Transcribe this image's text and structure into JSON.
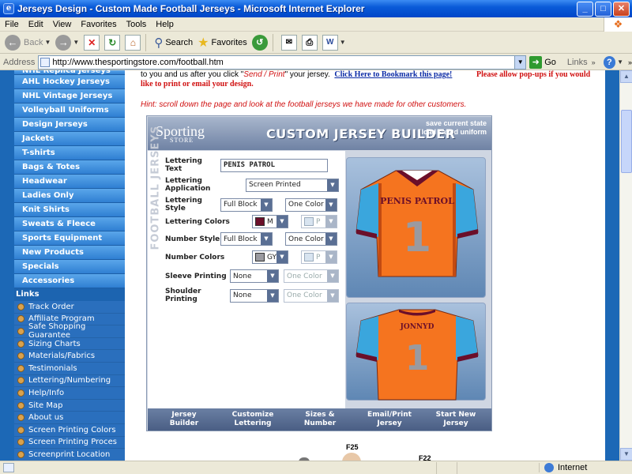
{
  "window": {
    "title": "Jerseys Design - Custom Made Football Jerseys - Microsoft Internet Explorer",
    "minimize": "_",
    "maximize": "□",
    "close": "✕"
  },
  "menu": [
    "File",
    "Edit",
    "View",
    "Favorites",
    "Tools",
    "Help"
  ],
  "toolbar": {
    "back": "Back",
    "search": "Search",
    "favorites": "Favorites"
  },
  "address": {
    "label": "Address",
    "url": "http://www.thesportingstore.com/football.htm",
    "go": "Go",
    "links": "Links"
  },
  "sidebar": {
    "categories": [
      "NHL Replica Jerseys",
      "AHL Hockey Jerseys",
      "NHL Vintage Jerseys",
      "Volleyball Uniforms",
      "Design Jerseys",
      "Jackets",
      "T-shirts",
      "Bags & Totes",
      "Headwear",
      "Ladies Only",
      "Knit Shirts",
      "Sweats & Fleece",
      "Sports Equipment",
      "New Products",
      "Specials",
      "Accessories"
    ],
    "links_header": "Links",
    "links": [
      "Track Order",
      "Affiliate Program",
      "Safe Shopping Guarantee",
      "Sizing Charts",
      "Materials/Fabrics",
      "Testimonials",
      "Lettering/Numbering",
      "Help/Info",
      "Site Map",
      "About us",
      "Screen Printing Colors",
      "Screen Printing Proces",
      "Screenprint Location"
    ]
  },
  "intro": {
    "line1_a": "to you and us after you click \"",
    "line1_q": "Send / Print",
    "line1_b": "\" your jersey.",
    "bookmark": "Click Here to Bookmark this page!",
    "line2": "like to print or email your design.",
    "popup": "Please allow pop-ups if you would",
    "hint": "Hint:  scroll down the page and  look at the football  jerseys we have made for other customers."
  },
  "builder": {
    "logo": "Sporting",
    "logo_sub": "STORE",
    "title": "CUSTOM JERSEY BUILDER",
    "save_state": "save current state",
    "load_uniform": "load saved uniform",
    "side_label": "FOOTBALL JERSEYS",
    "fields": {
      "lettering_text_label": "Lettering Text",
      "lettering_text_value": "PENIS PATROL",
      "lettering_app_label": "Lettering Application",
      "lettering_app_value": "Screen Printed",
      "lettering_style_label": "Lettering Style",
      "lettering_style_value": "Full Block",
      "lettering_style_colors": "One Color",
      "lettering_colors_label": "Lettering Colors",
      "lettering_color1": "M",
      "lettering_color2": "P",
      "number_style_label": "Number Style",
      "number_style_value": "Full Block",
      "number_style_colors": "One Color",
      "number_colors_label": "Number Colors",
      "number_color1": "GY",
      "number_color2": "P",
      "sleeve_label": "Sleeve Printing",
      "sleeve_value": "None",
      "sleeve_color": "One Color",
      "shoulder_label": "Shoulder Printing",
      "shoulder_value": "None",
      "shoulder_color": "One Color"
    },
    "front_text": "PENIS PATROL",
    "front_number": "1",
    "back_text": "JONNYD",
    "back_number": "1",
    "nav": [
      {
        "l1": "Jersey",
        "l2": "Builder"
      },
      {
        "l1": "Customize",
        "l2": "Lettering"
      },
      {
        "l1": "Sizes &",
        "l2": "Number"
      },
      {
        "l1": "Email/Print",
        "l2": "Jersey"
      },
      {
        "l1": "Start New",
        "l2": "Jersey"
      }
    ],
    "colors": {
      "jersey_body": "#F5741F",
      "sleeves": "#3AA6DD",
      "maroon": "#6B0F2A",
      "gray": "#9A9AA0"
    }
  },
  "below": {
    "f25": "F25",
    "f22": "F22"
  },
  "status": {
    "zone": "Internet"
  }
}
